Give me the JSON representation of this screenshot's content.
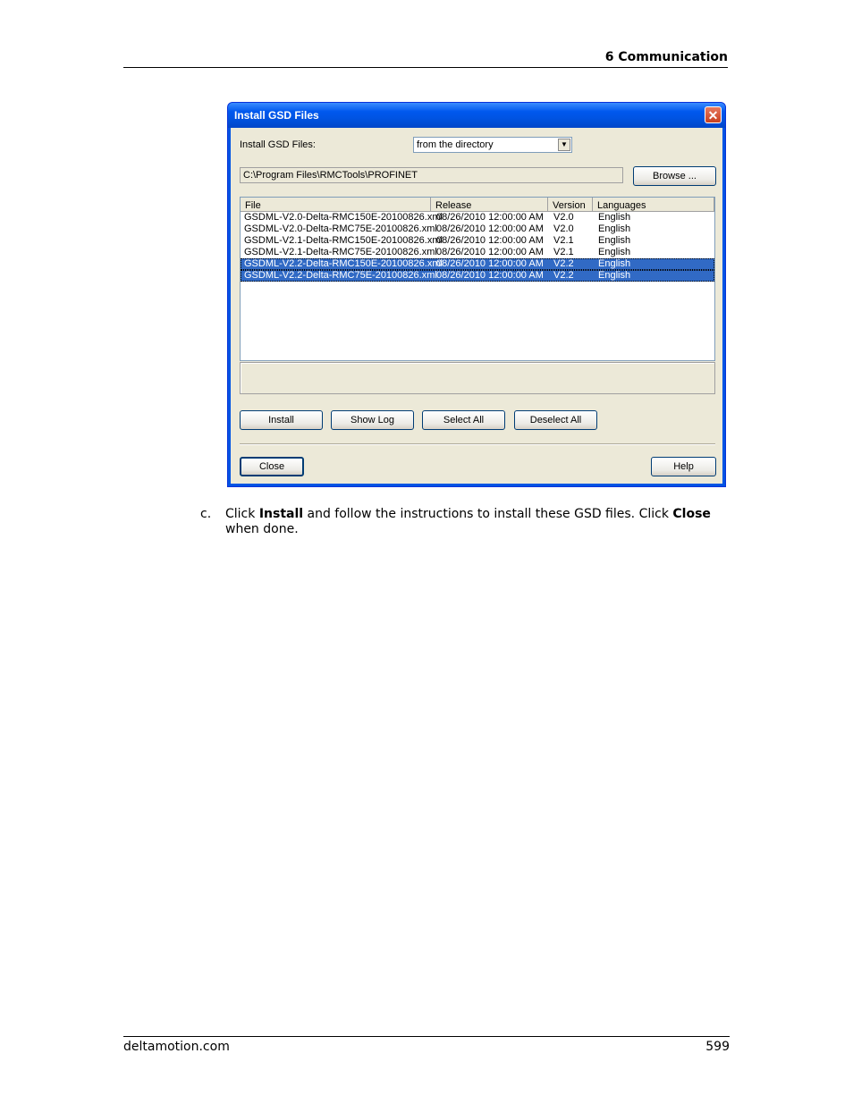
{
  "header": {
    "chapter": "6  Communication"
  },
  "dialog": {
    "title": "Install GSD Files",
    "install_label": "Install GSD Files:",
    "source_select": "from the directory",
    "path": "C:\\Program Files\\RMCTools\\PROFINET",
    "browse_label": "Browse ...",
    "columns": [
      "File",
      "Release",
      "Version",
      "Languages"
    ],
    "rows": [
      {
        "file": "GSDML-V2.0-Delta-RMC150E-20100826.xml",
        "release": "08/26/2010 12:00:00 AM",
        "version": "V2.0",
        "language": "English",
        "selected": false
      },
      {
        "file": "GSDML-V2.0-Delta-RMC75E-20100826.xml",
        "release": "08/26/2010 12:00:00 AM",
        "version": "V2.0",
        "language": "English",
        "selected": false
      },
      {
        "file": "GSDML-V2.1-Delta-RMC150E-20100826.xml",
        "release": "08/26/2010 12:00:00 AM",
        "version": "V2.1",
        "language": "English",
        "selected": false
      },
      {
        "file": "GSDML-V2.1-Delta-RMC75E-20100826.xml",
        "release": "08/26/2010 12:00:00 AM",
        "version": "V2.1",
        "language": "English",
        "selected": false
      },
      {
        "file": "GSDML-V2.2-Delta-RMC150E-20100826.xml",
        "release": "08/26/2010 12:00:00 AM",
        "version": "V2.2",
        "language": "English",
        "selected": true
      },
      {
        "file": "GSDML-V2.2-Delta-RMC75E-20100826.xml",
        "release": "08/26/2010 12:00:00 AM",
        "version": "V2.2",
        "language": "English",
        "selected": true
      }
    ],
    "buttons": {
      "install": "Install",
      "show_log": "Show Log",
      "select_all": "Select All",
      "deselect_all": "Deselect All",
      "close": "Close",
      "help": "Help"
    }
  },
  "instruction": {
    "marker": "c.",
    "pre": "Click ",
    "install_word": "Install",
    "mid": " and follow the instructions to install these GSD files. Click ",
    "close_word": "Close",
    "post": " when done."
  },
  "footer": {
    "site": "deltamotion.com",
    "page": "599"
  }
}
